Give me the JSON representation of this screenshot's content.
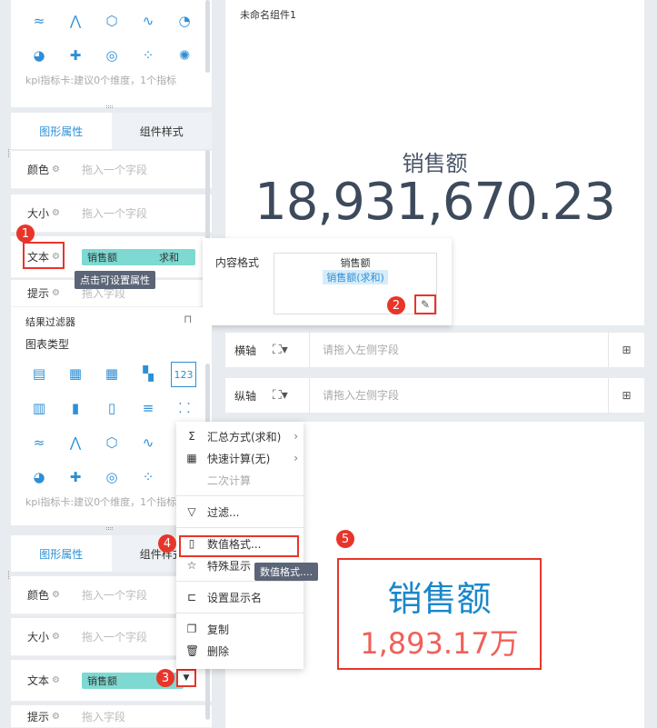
{
  "canvas": {
    "component_name": "未命名组件1",
    "kpi_title": "销售额",
    "kpi_value": "18,931,670.23"
  },
  "top_panel": {
    "kpi_hint": "kpi指标卡:建议0个维度，1个指标",
    "tabs": [
      "图形属性",
      "组件样式"
    ],
    "fields": {
      "color_label": "颜色",
      "size_label": "大小",
      "text_label": "文本",
      "tip_label": "提示"
    },
    "drop_placeholder": "拖入一个字段",
    "tip_placeholder": "拖入字段",
    "text_chip": {
      "field": "销售额",
      "agg": "求和"
    },
    "tooltip": "点击可设置属性"
  },
  "content_format": {
    "label": "内容格式",
    "line1": "销售额",
    "line2": "销售额(求和)"
  },
  "bottom_panel": {
    "filter_label": "结果过滤器",
    "chart_type_label": "图表类型",
    "selected_chart_icon": "123",
    "kpi_hint": "kpi指标卡:建议0个维度，1个指标",
    "tabs": [
      "图形属性",
      "组件样式"
    ],
    "fields": {
      "color_label": "颜色",
      "size_label": "大小",
      "text_label": "文本",
      "tip_label": "提示"
    },
    "drop_placeholder": "拖入一个字段",
    "tip_placeholder": "拖入字段",
    "text_chip": {
      "field": "销售额"
    }
  },
  "axes": {
    "x_label": "横轴",
    "y_label": "纵轴",
    "x_placeholder": "请拖入左侧字段",
    "y_placeholder": "请拖入左侧字段"
  },
  "context_menu": {
    "items": [
      {
        "label": "汇总方式(求和)",
        "icon": "sigma-icon"
      },
      {
        "label": "快速计算(无)",
        "icon": "grid-calc-icon"
      },
      {
        "label": "二次计算",
        "icon": ""
      },
      {
        "label": "过滤...",
        "icon": "filter-icon"
      },
      {
        "label": "数值格式...",
        "icon": "number-format-icon"
      },
      {
        "label": "特殊显示",
        "icon": "star-icon"
      },
      {
        "label": "设置显示名",
        "icon": "rename-icon"
      },
      {
        "label": "复制",
        "icon": "copy-icon"
      },
      {
        "label": "删除",
        "icon": "trash-icon"
      }
    ],
    "tooltip": "数值格式...."
  },
  "preview": {
    "title": "销售额",
    "value": "1,893.17万"
  },
  "badges": [
    "1",
    "2",
    "3",
    "4",
    "5"
  ],
  "colors": {
    "accent": "#2e8fd6",
    "chip": "#7dd9d2",
    "badge": "#e8352a",
    "preview_title": "#1b87c9",
    "preview_value": "#f0605a"
  }
}
